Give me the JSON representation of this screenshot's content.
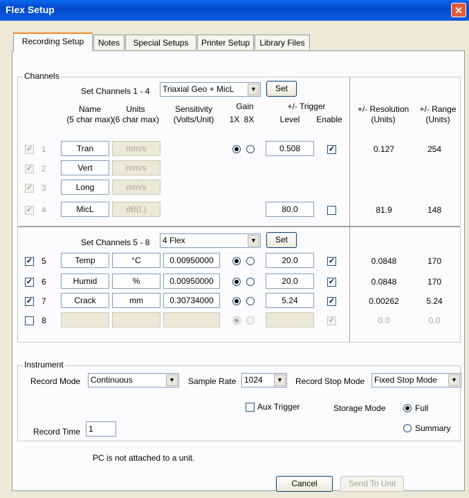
{
  "window": {
    "title": "Flex Setup",
    "close_glyph": "✕"
  },
  "tabs": [
    "Recording Setup",
    "Notes",
    "Special Setups",
    "Printer Setup",
    "Library Files"
  ],
  "channels": {
    "legend": "Channels",
    "set14_label": "Set Channels 1 - 4",
    "set14_value": "Triaxial Geo + MicL",
    "set58_label": "Set Channels 5 - 8",
    "set58_value": "4 Flex",
    "set_button": "Set",
    "headers": {
      "name": "Name",
      "name_sub": "(5 char max)",
      "units": "Units",
      "units_sub": "(6 char max)",
      "sensitivity": "Sensitivity",
      "sensitivity_sub": "(Volts/Unit)",
      "gain": "Gain",
      "gain_1x": "1X",
      "gain_8x": "8X",
      "trigger": "+/- Trigger",
      "trigger_level": "Level",
      "trigger_enable": "Enable",
      "resolution": "+/- Resolution",
      "resolution_sub": "(Units)",
      "range": "+/- Range",
      "range_sub": "(Units)"
    },
    "rows": [
      {
        "num": "1",
        "name": "Tran",
        "units": "mm/s",
        "sensitivity": "",
        "level": "0.508",
        "resolution": "0.127",
        "range": "254"
      },
      {
        "num": "2",
        "name": "Vert",
        "units": "mm/s",
        "sensitivity": "",
        "level": "",
        "resolution": "",
        "range": ""
      },
      {
        "num": "3",
        "name": "Long",
        "units": "mm/s",
        "sensitivity": "",
        "level": "",
        "resolution": "",
        "range": ""
      },
      {
        "num": "4",
        "name": "MicL",
        "units": "dB(L)",
        "sensitivity": "",
        "level": "80.0",
        "resolution": "81.9",
        "range": "148"
      },
      {
        "num": "5",
        "name": "Temp",
        "units": "°C",
        "sensitivity": "0.00950000",
        "level": "20.0",
        "resolution": "0.0848",
        "range": "170"
      },
      {
        "num": "6",
        "name": "Humid",
        "units": "%",
        "sensitivity": "0.00950000",
        "level": "20.0",
        "resolution": "0.0848",
        "range": "170"
      },
      {
        "num": "7",
        "name": "Crack",
        "units": "mm",
        "sensitivity": "0.30734000",
        "level": "5.24",
        "resolution": "0.00262",
        "range": "5.24"
      },
      {
        "num": "8",
        "name": "",
        "units": "",
        "sensitivity": "",
        "level": "",
        "resolution": "0.0",
        "range": "0.0"
      }
    ]
  },
  "instrument": {
    "legend": "Instrument",
    "record_mode_label": "Record Mode",
    "record_mode_value": "Continuous",
    "sample_rate_label": "Sample Rate",
    "sample_rate_value": "1024",
    "record_stop_label": "Record Stop Mode",
    "record_stop_value": "Fixed Stop Mode",
    "aux_trigger_label": "Aux Trigger",
    "storage_mode_label": "Storage Mode",
    "storage_full": "Full",
    "storage_summary": "Summary",
    "record_time_label": "Record Time",
    "record_time_value": "1"
  },
  "status": "PC is not attached to a unit.",
  "buttons": {
    "cancel": "Cancel",
    "send": "Send To Unit"
  },
  "icons": {
    "check": "✓",
    "arrow": "▼"
  }
}
